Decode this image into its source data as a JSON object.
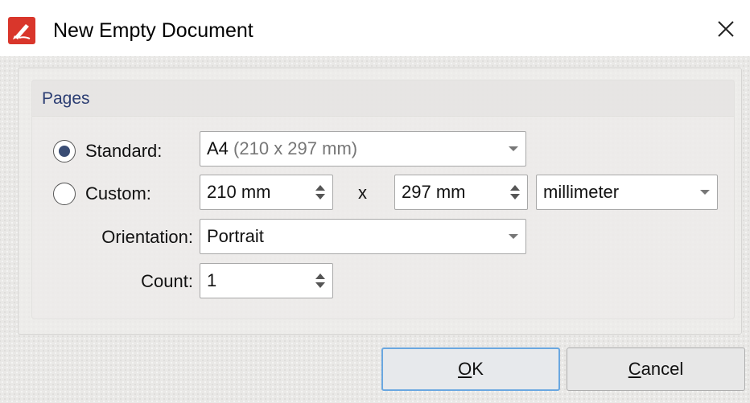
{
  "window": {
    "title": "New Empty Document",
    "icon": "pdf-editor-logo-icon"
  },
  "pages_group": {
    "title": "Pages",
    "standard": {
      "label": "Standard:",
      "selected": true,
      "value_main": "A4",
      "value_detail": "(210 x 297 mm)"
    },
    "custom": {
      "label": "Custom:",
      "selected": false,
      "width": "210 mm",
      "separator": "x",
      "height": "297 mm",
      "unit": "millimeter"
    },
    "orientation": {
      "label": "Orientation:",
      "value": "Portrait"
    },
    "count": {
      "label": "Count:",
      "value": "1"
    }
  },
  "buttons": {
    "ok": {
      "label_mnemonic": "O",
      "label_rest": "K"
    },
    "cancel": {
      "label_mnemonic": "C",
      "label_rest": "ancel"
    }
  },
  "colors": {
    "radio_dot": "#3a4d74",
    "default_button_border": "#6aa7e0",
    "logo_red": "#d9362b"
  }
}
